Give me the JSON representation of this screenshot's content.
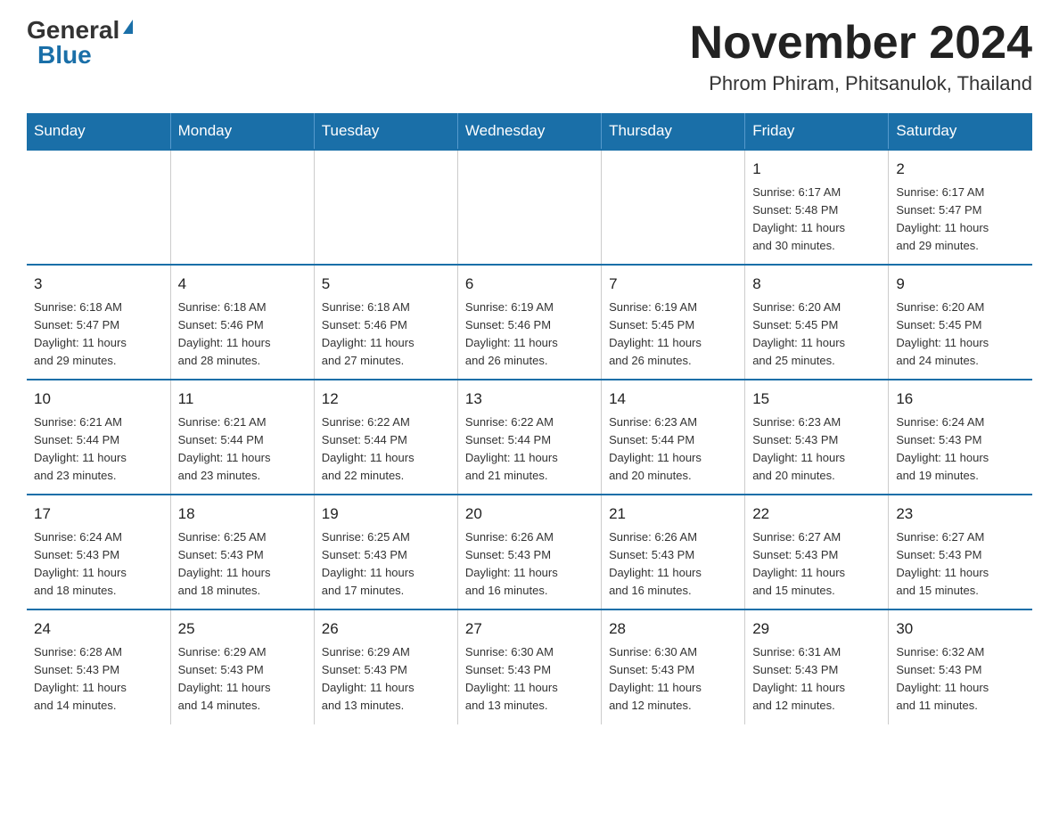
{
  "logo": {
    "general": "General",
    "blue": "Blue",
    "triangle": "▲"
  },
  "title": "November 2024",
  "location": "Phrom Phiram, Phitsanulok, Thailand",
  "days_of_week": [
    "Sunday",
    "Monday",
    "Tuesday",
    "Wednesday",
    "Thursday",
    "Friday",
    "Saturday"
  ],
  "weeks": [
    [
      {
        "day": "",
        "info": ""
      },
      {
        "day": "",
        "info": ""
      },
      {
        "day": "",
        "info": ""
      },
      {
        "day": "",
        "info": ""
      },
      {
        "day": "",
        "info": ""
      },
      {
        "day": "1",
        "info": "Sunrise: 6:17 AM\nSunset: 5:48 PM\nDaylight: 11 hours\nand 30 minutes."
      },
      {
        "day": "2",
        "info": "Sunrise: 6:17 AM\nSunset: 5:47 PM\nDaylight: 11 hours\nand 29 minutes."
      }
    ],
    [
      {
        "day": "3",
        "info": "Sunrise: 6:18 AM\nSunset: 5:47 PM\nDaylight: 11 hours\nand 29 minutes."
      },
      {
        "day": "4",
        "info": "Sunrise: 6:18 AM\nSunset: 5:46 PM\nDaylight: 11 hours\nand 28 minutes."
      },
      {
        "day": "5",
        "info": "Sunrise: 6:18 AM\nSunset: 5:46 PM\nDaylight: 11 hours\nand 27 minutes."
      },
      {
        "day": "6",
        "info": "Sunrise: 6:19 AM\nSunset: 5:46 PM\nDaylight: 11 hours\nand 26 minutes."
      },
      {
        "day": "7",
        "info": "Sunrise: 6:19 AM\nSunset: 5:45 PM\nDaylight: 11 hours\nand 26 minutes."
      },
      {
        "day": "8",
        "info": "Sunrise: 6:20 AM\nSunset: 5:45 PM\nDaylight: 11 hours\nand 25 minutes."
      },
      {
        "day": "9",
        "info": "Sunrise: 6:20 AM\nSunset: 5:45 PM\nDaylight: 11 hours\nand 24 minutes."
      }
    ],
    [
      {
        "day": "10",
        "info": "Sunrise: 6:21 AM\nSunset: 5:44 PM\nDaylight: 11 hours\nand 23 minutes."
      },
      {
        "day": "11",
        "info": "Sunrise: 6:21 AM\nSunset: 5:44 PM\nDaylight: 11 hours\nand 23 minutes."
      },
      {
        "day": "12",
        "info": "Sunrise: 6:22 AM\nSunset: 5:44 PM\nDaylight: 11 hours\nand 22 minutes."
      },
      {
        "day": "13",
        "info": "Sunrise: 6:22 AM\nSunset: 5:44 PM\nDaylight: 11 hours\nand 21 minutes."
      },
      {
        "day": "14",
        "info": "Sunrise: 6:23 AM\nSunset: 5:44 PM\nDaylight: 11 hours\nand 20 minutes."
      },
      {
        "day": "15",
        "info": "Sunrise: 6:23 AM\nSunset: 5:43 PM\nDaylight: 11 hours\nand 20 minutes."
      },
      {
        "day": "16",
        "info": "Sunrise: 6:24 AM\nSunset: 5:43 PM\nDaylight: 11 hours\nand 19 minutes."
      }
    ],
    [
      {
        "day": "17",
        "info": "Sunrise: 6:24 AM\nSunset: 5:43 PM\nDaylight: 11 hours\nand 18 minutes."
      },
      {
        "day": "18",
        "info": "Sunrise: 6:25 AM\nSunset: 5:43 PM\nDaylight: 11 hours\nand 18 minutes."
      },
      {
        "day": "19",
        "info": "Sunrise: 6:25 AM\nSunset: 5:43 PM\nDaylight: 11 hours\nand 17 minutes."
      },
      {
        "day": "20",
        "info": "Sunrise: 6:26 AM\nSunset: 5:43 PM\nDaylight: 11 hours\nand 16 minutes."
      },
      {
        "day": "21",
        "info": "Sunrise: 6:26 AM\nSunset: 5:43 PM\nDaylight: 11 hours\nand 16 minutes."
      },
      {
        "day": "22",
        "info": "Sunrise: 6:27 AM\nSunset: 5:43 PM\nDaylight: 11 hours\nand 15 minutes."
      },
      {
        "day": "23",
        "info": "Sunrise: 6:27 AM\nSunset: 5:43 PM\nDaylight: 11 hours\nand 15 minutes."
      }
    ],
    [
      {
        "day": "24",
        "info": "Sunrise: 6:28 AM\nSunset: 5:43 PM\nDaylight: 11 hours\nand 14 minutes."
      },
      {
        "day": "25",
        "info": "Sunrise: 6:29 AM\nSunset: 5:43 PM\nDaylight: 11 hours\nand 14 minutes."
      },
      {
        "day": "26",
        "info": "Sunrise: 6:29 AM\nSunset: 5:43 PM\nDaylight: 11 hours\nand 13 minutes."
      },
      {
        "day": "27",
        "info": "Sunrise: 6:30 AM\nSunset: 5:43 PM\nDaylight: 11 hours\nand 13 minutes."
      },
      {
        "day": "28",
        "info": "Sunrise: 6:30 AM\nSunset: 5:43 PM\nDaylight: 11 hours\nand 12 minutes."
      },
      {
        "day": "29",
        "info": "Sunrise: 6:31 AM\nSunset: 5:43 PM\nDaylight: 11 hours\nand 12 minutes."
      },
      {
        "day": "30",
        "info": "Sunrise: 6:32 AM\nSunset: 5:43 PM\nDaylight: 11 hours\nand 11 minutes."
      }
    ]
  ]
}
